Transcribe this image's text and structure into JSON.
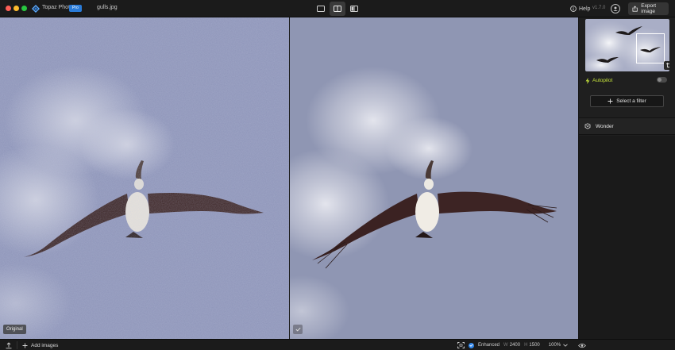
{
  "app": {
    "name": "Topaz Photo",
    "edition_badge": "Pro",
    "filename": "gulls.jpg",
    "version": "v1.7.0"
  },
  "titlebar": {
    "view_modes": [
      "single-view",
      "split-view",
      "side-by-side-view"
    ],
    "active_view": "split-view",
    "help_label": "Help",
    "export_label": "Export image"
  },
  "canvas": {
    "left_label": "Original",
    "subject": "pelican in flight against cloudy sky"
  },
  "sidebar": {
    "autopilot_label": "Autopilot",
    "autopilot_on": false,
    "select_filter_label": "Select a filter",
    "filters": [
      {
        "label": "Wonder",
        "icon": "wonder-icon"
      }
    ]
  },
  "bottombar": {
    "add_images_label": "Add images",
    "enhanced_label": "Enhanced",
    "width_key": "W",
    "width_value": "2400",
    "height_key": "H",
    "height_value": "1500",
    "zoom": "100%"
  },
  "colors": {
    "accent_blue": "#2f85e9",
    "autopilot_green": "#c6e33c",
    "sky_noisy": "#8e95b9",
    "sky_clean": "#8f96b3"
  }
}
